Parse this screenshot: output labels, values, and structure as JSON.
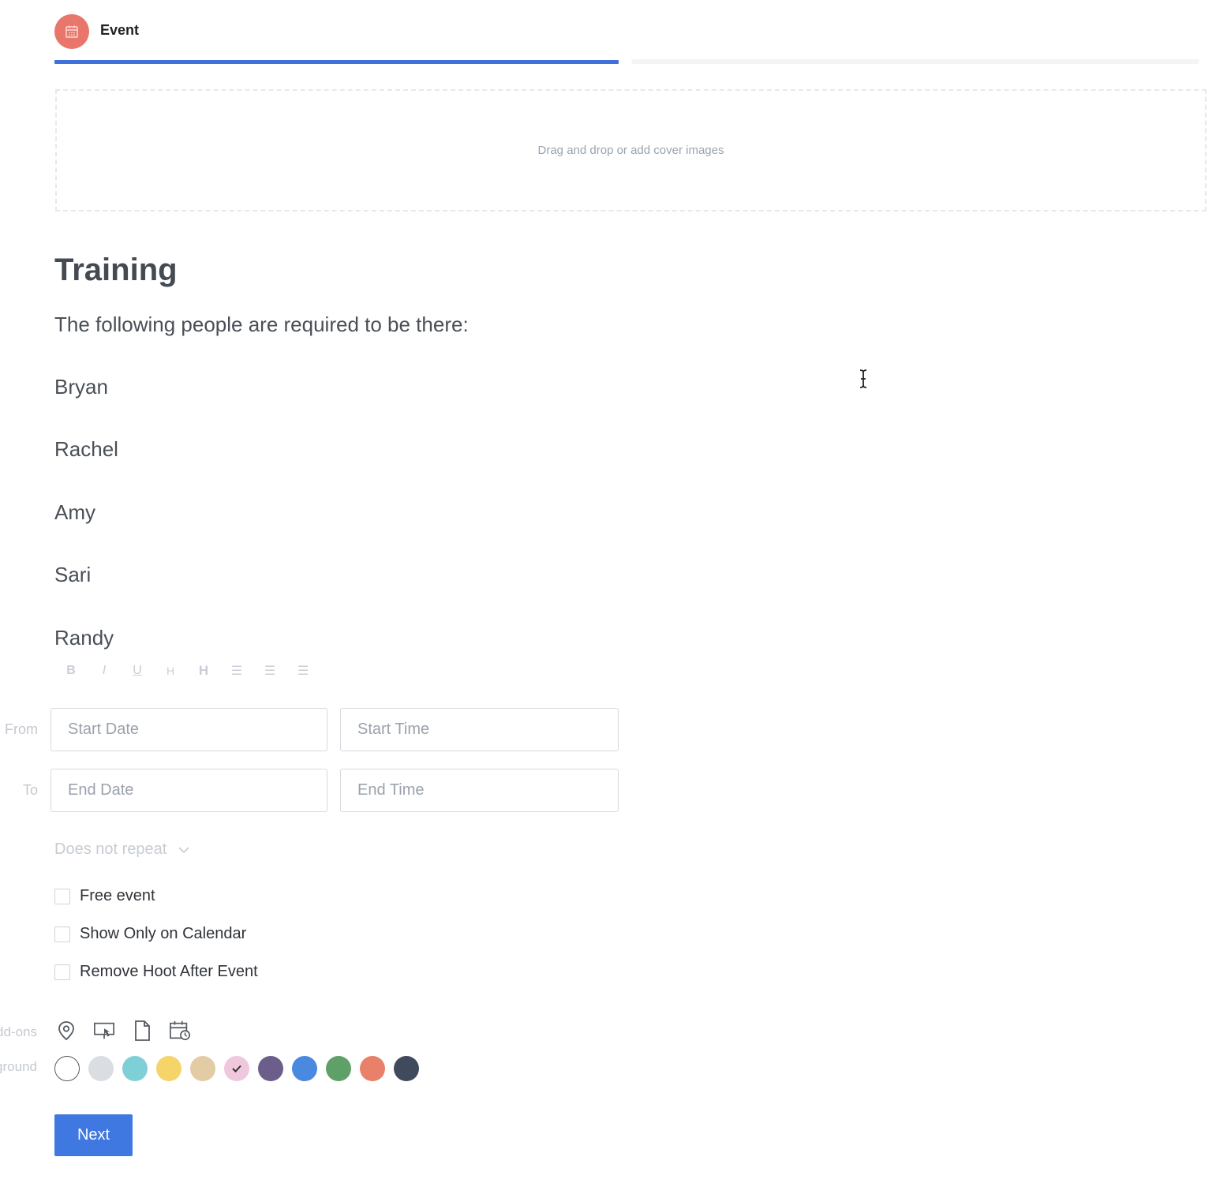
{
  "header": {
    "step_label": "Event",
    "step_icon": "calendar-icon",
    "accent": "#3f6fd8",
    "icon_color": "#e8766a",
    "progress": 0.5
  },
  "cover": {
    "text": "Drag and drop or add cover images"
  },
  "event": {
    "title": "Training",
    "intro": "The following people are required to be there:",
    "people": [
      "Bryan",
      "Rachel",
      "Amy",
      "Sari",
      "Randy"
    ]
  },
  "toolbar": {
    "buttons": [
      {
        "name": "bold-button",
        "glyph": "B"
      },
      {
        "name": "italic-button",
        "glyph": "I"
      },
      {
        "name": "underline-button",
        "glyph": "U"
      },
      {
        "name": "heading-small-button",
        "glyph": "H"
      },
      {
        "name": "heading-large-button",
        "glyph": "H"
      },
      {
        "name": "indent-button",
        "glyph": "☰"
      },
      {
        "name": "bulleted-list-button",
        "glyph": "☰"
      },
      {
        "name": "numbered-list-button",
        "glyph": "☰"
      }
    ]
  },
  "schedule": {
    "from_label": "From",
    "to_label": "To",
    "start_date_placeholder": "Start Date",
    "start_time_placeholder": "Start Time",
    "end_date_placeholder": "End Date",
    "end_time_placeholder": "End Time",
    "repeat": "Does not repeat"
  },
  "options": {
    "free_event": "Free event",
    "show_only_calendar": "Show Only on Calendar",
    "remove_hoot": "Remove Hoot After Event"
  },
  "addons": {
    "label": "Add-ons",
    "icons": [
      "location-pin-icon",
      "presentation-icon",
      "document-icon",
      "calendar-clock-icon"
    ]
  },
  "background": {
    "label": "Background",
    "colors": [
      "#ffffff",
      "#dadde1",
      "#7fcfd7",
      "#f5d46a",
      "#e3cca4",
      "#f0c8dd",
      "#6b5e8a",
      "#4a89e0",
      "#5fa068",
      "#e8806a",
      "#3f4a5c"
    ],
    "selected_index": 5
  },
  "actions": {
    "next_label": "Next",
    "button_color": "#3f78e0"
  }
}
